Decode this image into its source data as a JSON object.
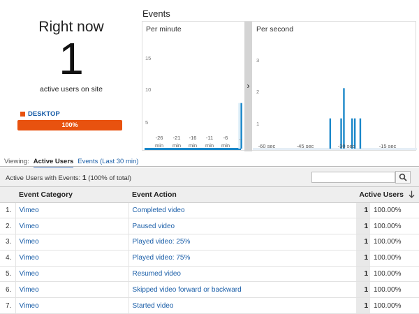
{
  "summary": {
    "title": "Right now",
    "active_users": "1",
    "subtitle": "active users on site",
    "device_label": "DESKTOP",
    "device_percent": "100%",
    "device_share": 1.0,
    "device_color": "#e8520f"
  },
  "events": {
    "title": "Events",
    "per_minute": {
      "label": "Per minute",
      "y_ticks": [
        "15",
        "10",
        "5"
      ],
      "x_ticks": [
        {
          "top": "-26",
          "bottom": "min"
        },
        {
          "top": "-21",
          "bottom": "min"
        },
        {
          "top": "-16",
          "bottom": "min"
        },
        {
          "top": "-11",
          "bottom": "min"
        },
        {
          "top": "-6",
          "bottom": "min"
        },
        {
          "top": "..",
          "bottom": ""
        }
      ],
      "values": [
        0,
        0,
        0,
        0,
        0,
        0,
        0,
        0,
        0,
        0,
        0,
        0,
        0,
        0,
        0,
        0,
        0,
        0,
        0,
        0,
        0,
        0,
        0,
        0,
        0,
        0,
        0,
        0,
        0,
        7
      ],
      "ymax": 15
    },
    "per_second": {
      "label": "Per second",
      "y_ticks": [
        "3",
        "2",
        "1"
      ],
      "x_ticks": [
        "-60 sec",
        "-45 sec",
        "-30 sec",
        "-15 sec"
      ],
      "values": [
        0,
        0,
        0,
        0,
        0,
        0,
        0,
        0,
        0,
        0,
        0,
        0,
        0,
        0,
        0,
        0,
        0,
        0,
        0,
        0,
        0,
        0,
        0,
        0,
        0,
        0,
        0,
        0,
        1,
        0,
        0,
        0,
        1,
        2,
        0,
        0,
        1,
        1,
        0,
        1,
        0,
        0,
        0,
        0,
        0,
        0,
        0,
        0,
        0,
        0,
        0,
        0,
        0,
        0,
        0,
        0,
        0,
        0,
        0,
        0
      ],
      "ymax": 3
    },
    "expand_arrow": "›",
    "bar_color": "#1a87c9",
    "baseline_color": "#1a87c9"
  },
  "viewing": {
    "label": "Viewing:",
    "active_tab": "Active Users",
    "other_tab": "Events (Last 30 min)"
  },
  "table_summary": {
    "prefix": "Active Users with Events:",
    "count": "1",
    "pct": "(100% of total)"
  },
  "table": {
    "headers": {
      "category": "Event Category",
      "action": "Event Action",
      "users": "Active Users"
    },
    "rows": [
      {
        "idx": "1.",
        "category": "Vimeo",
        "action": "Completed video",
        "users": "1",
        "pct": "100.00%"
      },
      {
        "idx": "2.",
        "category": "Vimeo",
        "action": "Paused video",
        "users": "1",
        "pct": "100.00%"
      },
      {
        "idx": "3.",
        "category": "Vimeo",
        "action": "Played video: 25%",
        "users": "1",
        "pct": "100.00%"
      },
      {
        "idx": "4.",
        "category": "Vimeo",
        "action": "Played video: 75%",
        "users": "1",
        "pct": "100.00%"
      },
      {
        "idx": "5.",
        "category": "Vimeo",
        "action": "Resumed video",
        "users": "1",
        "pct": "100.00%"
      },
      {
        "idx": "6.",
        "category": "Vimeo",
        "action": "Skipped video forward or backward",
        "users": "1",
        "pct": "100.00%"
      },
      {
        "idx": "7.",
        "category": "Vimeo",
        "action": "Started video",
        "users": "1",
        "pct": "100.00%"
      }
    ]
  }
}
